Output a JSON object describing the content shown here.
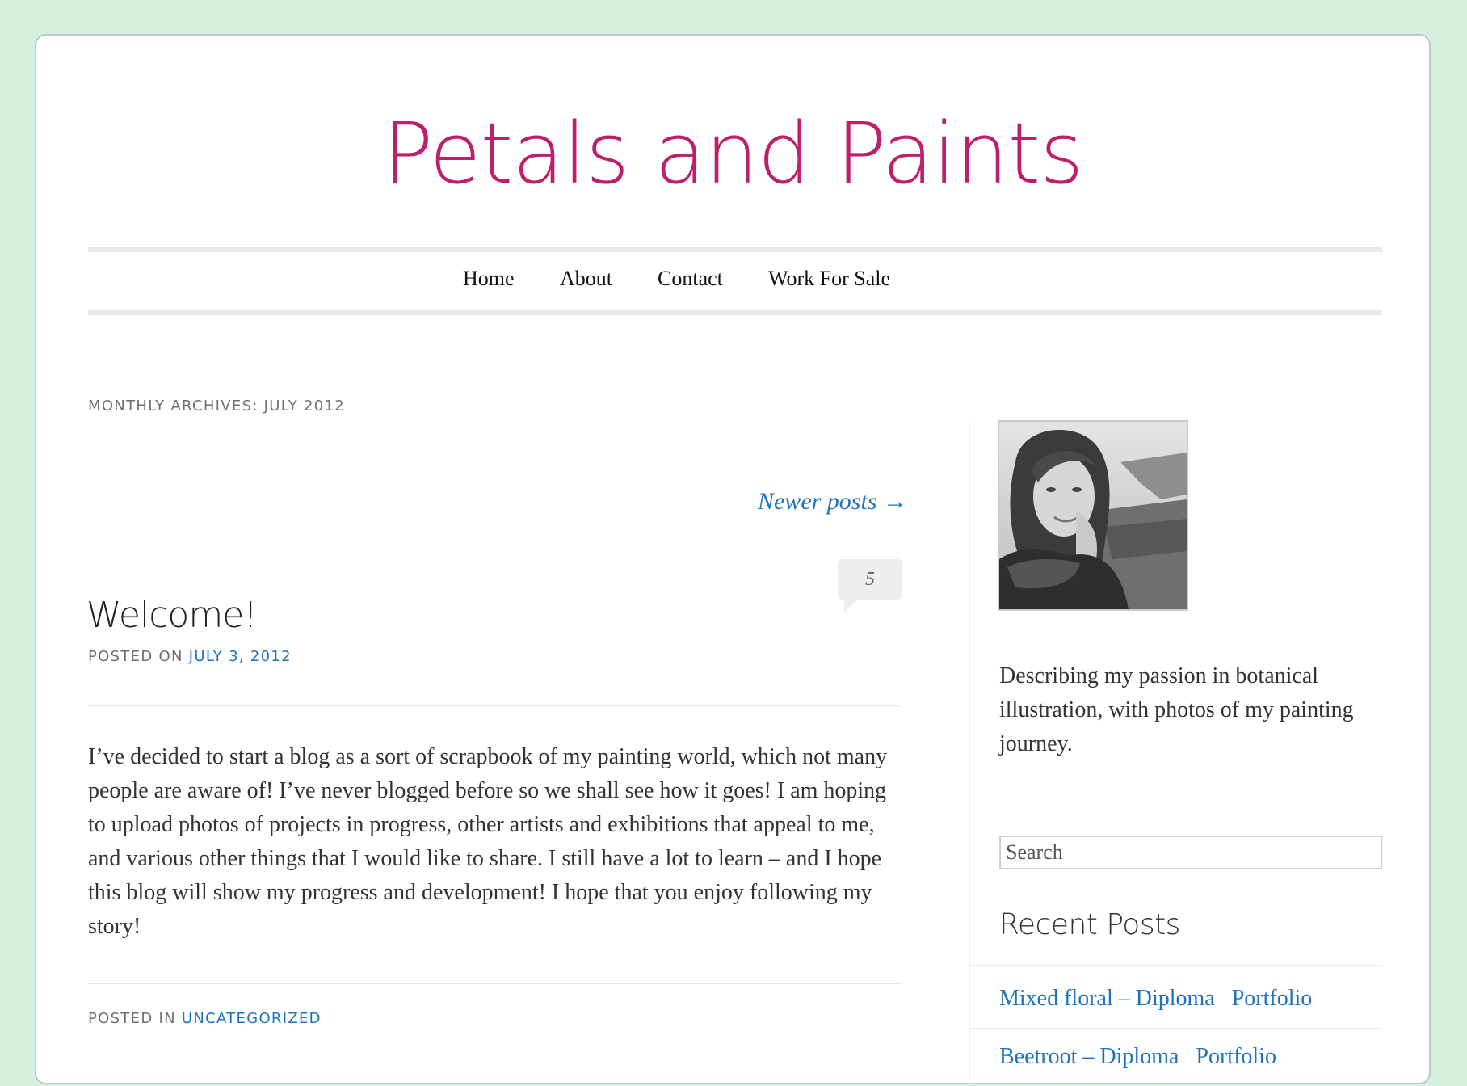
{
  "site": {
    "title": "Petals and Paints"
  },
  "nav": {
    "items": [
      {
        "label": "Home"
      },
      {
        "label": "About"
      },
      {
        "label": "Contact"
      },
      {
        "label": "Work For Sale"
      }
    ]
  },
  "archive": {
    "title": "MONTHLY ARCHIVES: JULY 2012",
    "newer_posts": "Newer posts →"
  },
  "post": {
    "title": "Welcome!",
    "comment_count": "5",
    "posted_on_label": "POSTED ON ",
    "date": "JULY 3, 2012",
    "body": "I’ve decided to start a blog as a sort of scrapbook of my painting world, which not many people are aware of! I’ve never blogged before so we shall see how it goes! I am hoping to upload photos of projects in progress, other artists and exhibitions that appeal to me, and various other things that I would like to share.   I still have a lot to learn – and I hope this blog will show my progress and development! I hope that you enjoy following my story!",
    "posted_in_label": "POSTED IN ",
    "category": "UNCATEGORIZED"
  },
  "sidebar": {
    "description": "Describing my passion in botanical illustration, with photos of my painting journey.",
    "search_placeholder": "Search",
    "recent_posts_title": "Recent Posts",
    "recent_posts": [
      {
        "label": "Mixed floral – Diploma   Portfolio"
      },
      {
        "label": "Beetroot – Diploma   Portfolio"
      }
    ]
  },
  "colors": {
    "background": "#d4f0df",
    "title_pink": "#be1e6b",
    "link_blue": "#1e73be"
  },
  "icons": {
    "comment_bubble": "speech-bubble-icon",
    "avatar": "portrait-photo"
  }
}
